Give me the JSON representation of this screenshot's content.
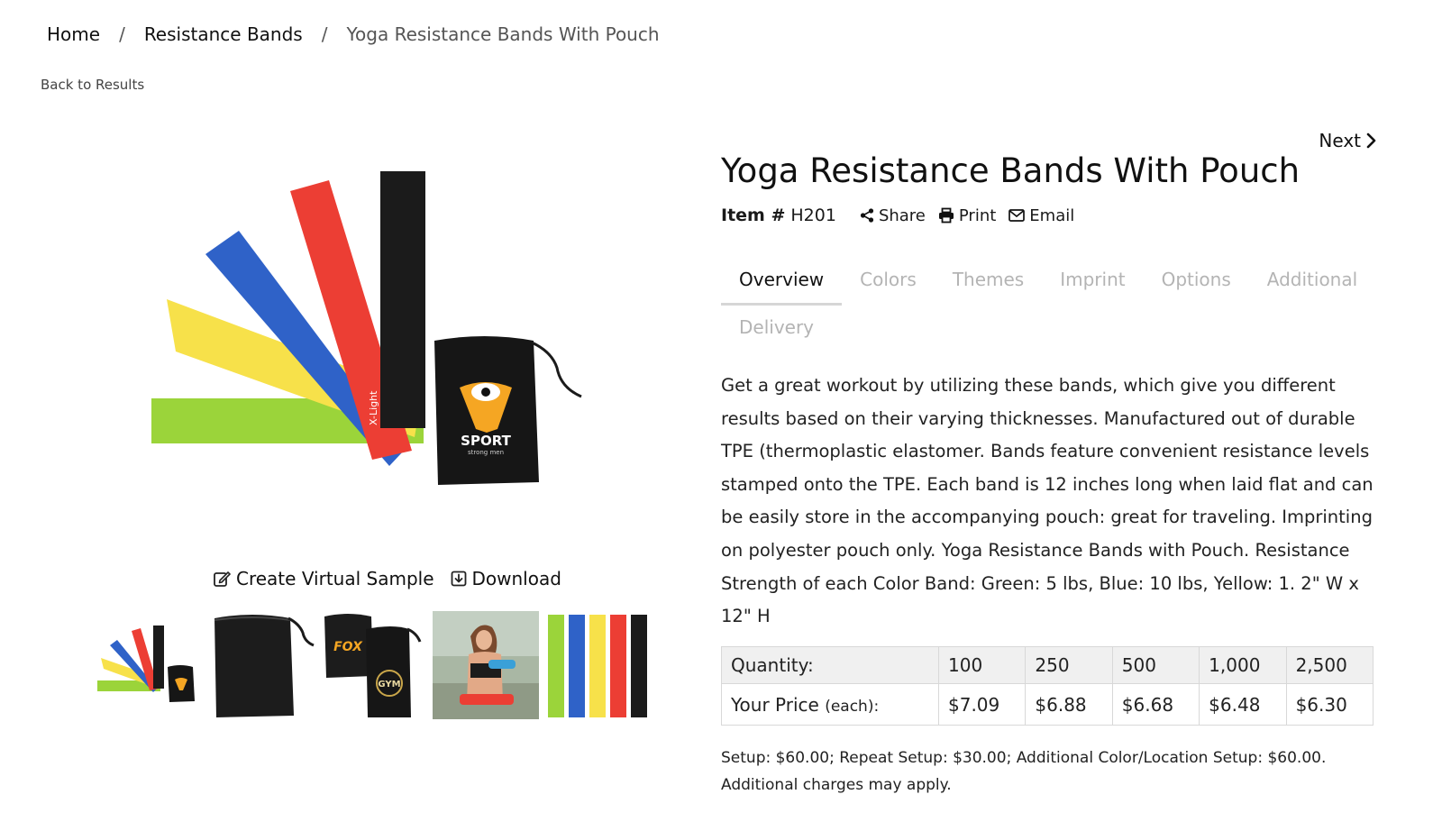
{
  "breadcrumb": {
    "home": "Home",
    "category": "Resistance Bands",
    "current": "Yoga Resistance Bands With Pouch",
    "separator": "/"
  },
  "back_link": "Back to Results",
  "next_link": "Next",
  "product": {
    "title": "Yoga Resistance Bands With Pouch",
    "item_label": "Item #",
    "item_number": "H201",
    "actions": {
      "share": "Share",
      "print": "Print",
      "email": "Email"
    }
  },
  "image_actions": {
    "virtual_sample": "Create Virtual Sample",
    "download": "Download"
  },
  "hero_image": {
    "pouch_logo": "SPORT",
    "pouch_tagline": "strong men",
    "band_label": "X-Light"
  },
  "thumbnails": [
    {
      "name": "bands-and-pouch"
    },
    {
      "name": "black-pouch"
    },
    {
      "name": "pouches-logos",
      "logo_text_1": "FOX",
      "logo_text_2": "GYM"
    },
    {
      "name": "woman-using-bands"
    },
    {
      "name": "five-bands-lineup"
    }
  ],
  "tabs": [
    "Overview",
    "Colors",
    "Themes",
    "Imprint",
    "Options",
    "Additional",
    "Delivery"
  ],
  "active_tab": "Overview",
  "description": "Get a great workout by utilizing these bands, which give you different results based on their varying thicknesses. Manufactured out of durable TPE (thermoplastic elastomer. Bands feature convenient resistance levels stamped onto the TPE. Each band is 12 inches long when laid flat and can be easily store in the accompanying pouch: great for traveling. Imprinting on polyester pouch only. Yoga Resistance Bands with Pouch. Resistance Strength of each Color Band: Green: 5 lbs, Blue: 10 lbs, Yellow: 1. 2\" W x 12\" H",
  "pricing": {
    "quantity_label": "Quantity:",
    "price_label": "Your Price",
    "price_suffix": "(each):",
    "quantities": [
      "100",
      "250",
      "500",
      "1,000",
      "2,500"
    ],
    "prices": [
      "$7.09",
      "$6.88",
      "$6.68",
      "$6.48",
      "$6.30"
    ]
  },
  "setup_note": "Setup: $60.00; Repeat Setup: $30.00; Additional Color/Location Setup: $60.00. Additional charges may apply.",
  "colors": {
    "band_green": "#9bd43a",
    "band_yellow": "#f7e14a",
    "band_blue": "#2f62c8",
    "band_red": "#ec3e34",
    "band_black": "#1b1b1b",
    "logo_orange": "#f5a623"
  }
}
